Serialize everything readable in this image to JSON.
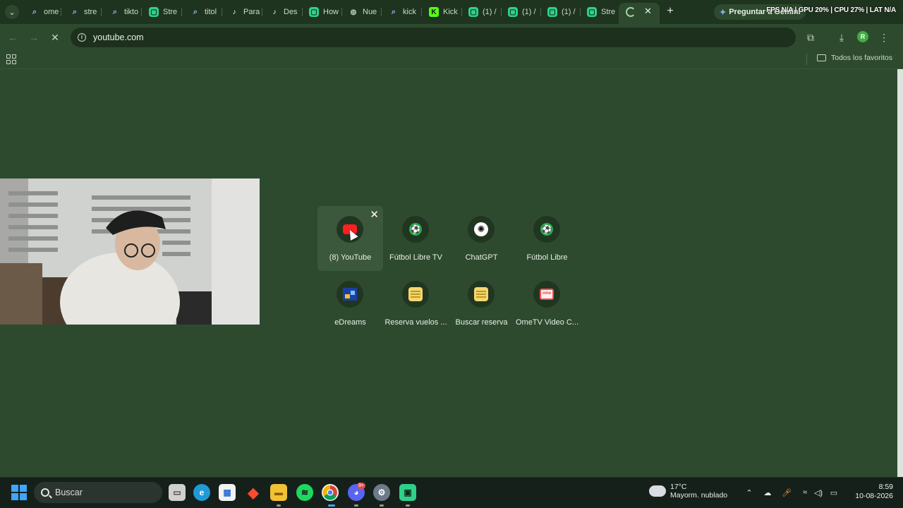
{
  "browser": {
    "tabs": [
      {
        "label": "ome",
        "favicon": "search-icon"
      },
      {
        "label": "stre",
        "favicon": "search-icon"
      },
      {
        "label": "tikto",
        "favicon": "search-icon"
      },
      {
        "label": "Stre",
        "favicon": "green-app-icon"
      },
      {
        "label": "titol",
        "favicon": "search-icon"
      },
      {
        "label": "Para",
        "favicon": "tiktok-icon"
      },
      {
        "label": "Des",
        "favicon": "tiktok-icon"
      },
      {
        "label": "How",
        "favicon": "green-app-icon"
      },
      {
        "label": "Nue",
        "favicon": "globe-icon"
      },
      {
        "label": "kick",
        "favicon": "search-icon"
      },
      {
        "label": "Kick",
        "favicon": "kick-icon"
      },
      {
        "label": "(1) /",
        "favicon": "green-app-icon"
      },
      {
        "label": "(1) /",
        "favicon": "green-app-icon"
      },
      {
        "label": "(1) /",
        "favicon": "green-app-icon"
      },
      {
        "label": "Stre",
        "favicon": "green-app-icon"
      }
    ],
    "gemini_label": "Preguntar a Gemini",
    "perf_overlay": "FPS N/A | GPU 20% | CPU 27% | LAT N/A",
    "address": "youtube.com",
    "profile_initial": "R",
    "all_bookmarks_label": "Todos los favoritos"
  },
  "shortcuts": [
    {
      "title": "(8) YouTube",
      "icon": "youtube-icon"
    },
    {
      "title": "Fútbol Libre TV",
      "icon": "soccer-ball-icon"
    },
    {
      "title": "ChatGPT",
      "icon": "openai-icon"
    },
    {
      "title": "Fútbol Libre",
      "icon": "soccer-ball-icon"
    },
    {
      "title": "eDreams",
      "icon": "edreams-icon"
    },
    {
      "title": "Reserva vuelos ...",
      "icon": "note-icon"
    },
    {
      "title": "Buscar reserva",
      "icon": "note-icon"
    },
    {
      "title": "OmeTV Video C...",
      "icon": "ometv-icon"
    }
  ],
  "shortcut_close": "✕",
  "taskbar": {
    "search_placeholder": "Buscar",
    "weather_temp": "17°C",
    "weather_desc": "Mayorm. nublado",
    "discord_badge": "9+",
    "time": "8:59",
    "date": "10-08-2026"
  },
  "colors": {
    "page_background": "#2e4a2e",
    "tabstrip": "#1f341f",
    "taskbar": "#15201a",
    "accent": "#3fae43"
  }
}
